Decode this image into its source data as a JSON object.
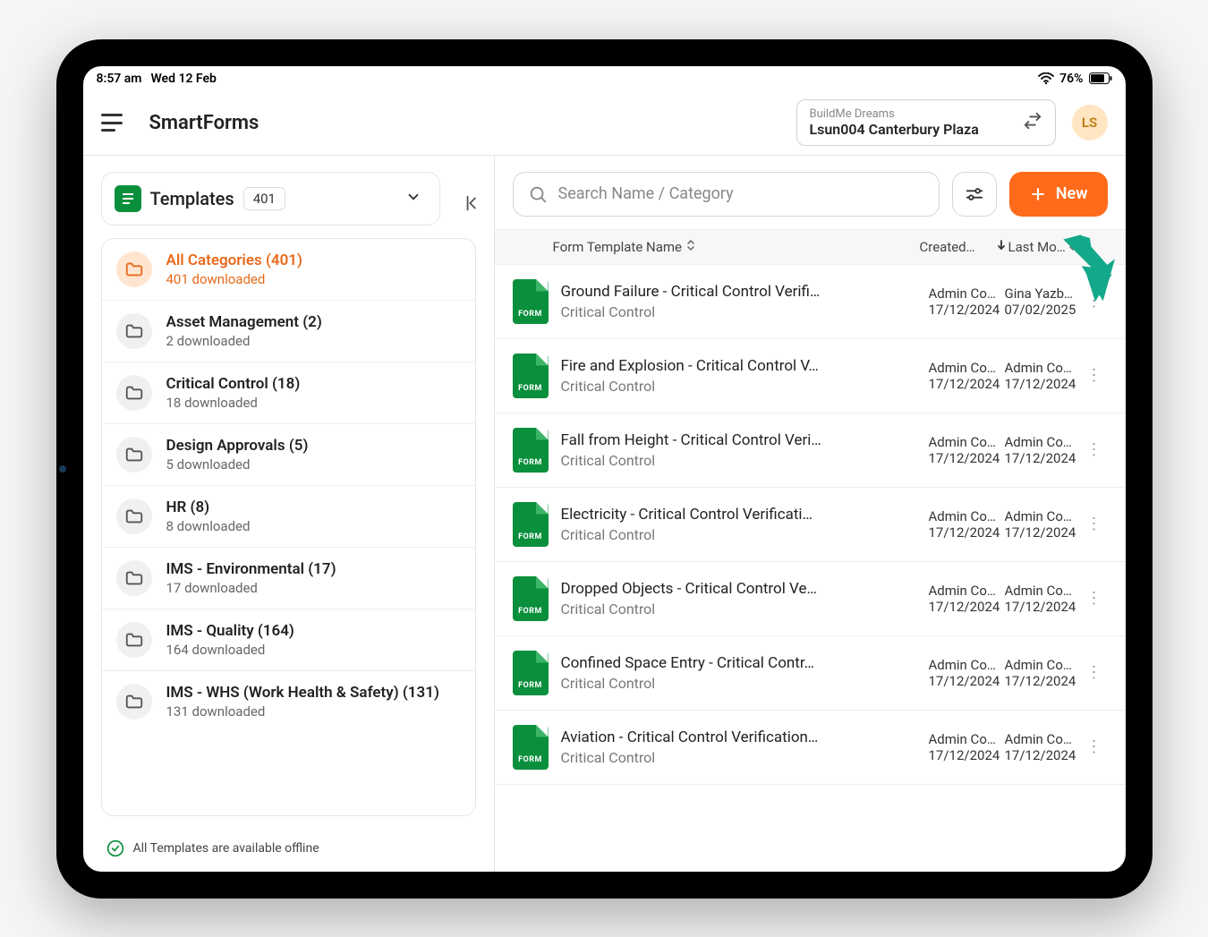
{
  "status": {
    "time": "8:57 am",
    "date": "Wed 12 Feb",
    "battery": "76%"
  },
  "header": {
    "app_title": "SmartForms",
    "project_org": "BuildMe Dreams",
    "project_name": "Lsun004 Canterbury Plaza",
    "avatar_initials": "LS"
  },
  "sidebar": {
    "templates_label": "Templates",
    "templates_count": "401",
    "offline_text": "All Templates are available offline",
    "categories": [
      {
        "title": "All Categories (401)",
        "sub": "401 downloaded",
        "active": true
      },
      {
        "title": "Asset Management (2)",
        "sub": "2 downloaded",
        "active": false
      },
      {
        "title": "Critical Control (18)",
        "sub": "18 downloaded",
        "active": false
      },
      {
        "title": "Design Approvals (5)",
        "sub": "5 downloaded",
        "active": false
      },
      {
        "title": "HR (8)",
        "sub": "8 downloaded",
        "active": false
      },
      {
        "title": "IMS - Environmental (17)",
        "sub": "17 downloaded",
        "active": false
      },
      {
        "title": "IMS - Quality (164)",
        "sub": "164 downloaded",
        "active": false
      },
      {
        "title": "IMS - WHS (Work Health & Safety) (131)",
        "sub": "131 downloaded",
        "active": false
      }
    ]
  },
  "toolbar": {
    "search_placeholder": "Search Name / Category",
    "new_label": "New"
  },
  "table": {
    "header_name": "Form Template Name",
    "header_created": "Created…",
    "header_modified": "Last Mo…",
    "icon_label": "FORM",
    "rows": [
      {
        "title": "Ground Failure - Critical Control Verifi…",
        "category": "Critical Control",
        "created_by": "Admin Co…",
        "created_date": "17/12/2024",
        "modified_by": "Gina Yazb…",
        "modified_date": "07/02/2025"
      },
      {
        "title": "Fire and Explosion - Critical Control V…",
        "category": "Critical Control",
        "created_by": "Admin Co…",
        "created_date": "17/12/2024",
        "modified_by": "Admin Co…",
        "modified_date": "17/12/2024"
      },
      {
        "title": "Fall from Height - Critical Control Veri…",
        "category": "Critical Control",
        "created_by": "Admin Co…",
        "created_date": "17/12/2024",
        "modified_by": "Admin Co…",
        "modified_date": "17/12/2024"
      },
      {
        "title": "Electricity - Critical Control Verificati…",
        "category": "Critical Control",
        "created_by": "Admin Co…",
        "created_date": "17/12/2024",
        "modified_by": "Admin Co…",
        "modified_date": "17/12/2024"
      },
      {
        "title": "Dropped Objects - Critical Control Ve…",
        "category": "Critical Control",
        "created_by": "Admin Co…",
        "created_date": "17/12/2024",
        "modified_by": "Admin Co…",
        "modified_date": "17/12/2024"
      },
      {
        "title": "Confined Space Entry - Critical Contr…",
        "category": "Critical Control",
        "created_by": "Admin Co…",
        "created_date": "17/12/2024",
        "modified_by": "Admin Co…",
        "modified_date": "17/12/2024"
      },
      {
        "title": "Aviation - Critical Control Verification…",
        "category": "Critical Control",
        "created_by": "Admin Co…",
        "created_date": "17/12/2024",
        "modified_by": "Admin Co…",
        "modified_date": "17/12/2024"
      }
    ]
  }
}
